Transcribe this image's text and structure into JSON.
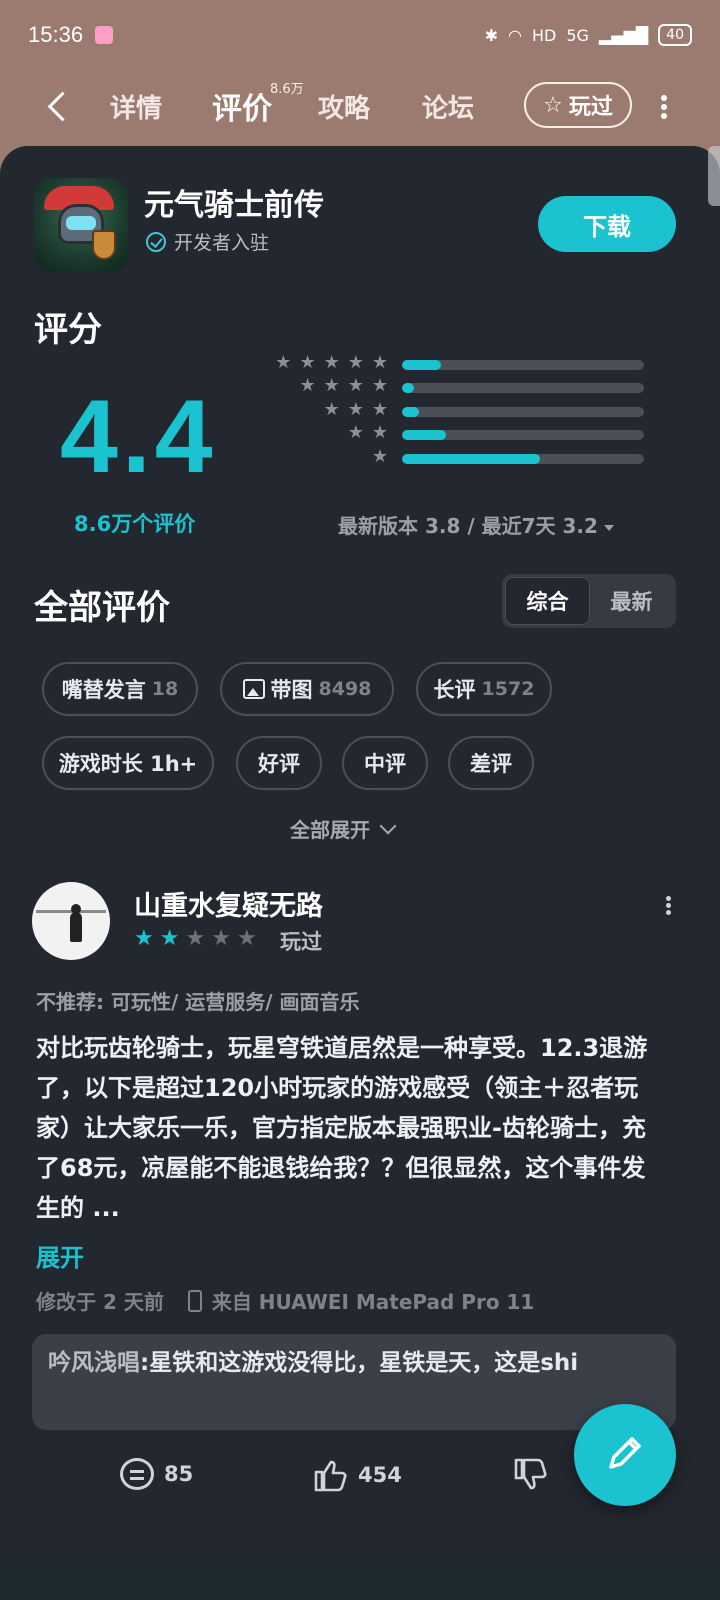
{
  "status_bar": {
    "time": "15:36",
    "network": "5G",
    "hd_label": "HD",
    "battery": "40"
  },
  "nav": {
    "tabs": [
      {
        "label": "详情"
      },
      {
        "label": "评价",
        "count": "8.6万"
      },
      {
        "label": "攻略"
      },
      {
        "label": "论坛"
      }
    ],
    "played_label": "玩过"
  },
  "app": {
    "title": "元气骑士前传",
    "developer_badge": "开发者入驻",
    "download_label": "下载"
  },
  "rating": {
    "section_title": "评分",
    "score": "4.4",
    "review_count_label": "8.6万个评价",
    "version_rating": "最新版本 3.8 / 最近7天 3.2",
    "distribution": [
      {
        "stars": 5,
        "fraction": 0.16
      },
      {
        "stars": 4,
        "fraction": 0.05
      },
      {
        "stars": 3,
        "fraction": 0.07
      },
      {
        "stars": 2,
        "fraction": 0.18
      },
      {
        "stars": 1,
        "fraction": 0.57
      }
    ]
  },
  "reviews": {
    "section_title": "全部评价",
    "sort_options": [
      "综合",
      "最新"
    ],
    "filters": [
      {
        "label": "嘴替发言",
        "count": "18"
      },
      {
        "label": "带图",
        "count": "8498"
      },
      {
        "label": "长评",
        "count": "1572"
      },
      {
        "label": "游戏时长 1h+",
        "count": ""
      },
      {
        "label": "好评",
        "count": ""
      },
      {
        "label": "中评",
        "count": ""
      },
      {
        "label": "差评",
        "count": ""
      }
    ],
    "expand_all_label": "全部展开"
  },
  "review": {
    "username": "山重水复疑无路",
    "stars": 2,
    "played_tag": "玩过",
    "not_recommend": "不推荐: 可玩性/ 运营服务/ 画面音乐",
    "text": "对比玩齿轮骑士，玩星穹铁道居然是一种享受。12.3退游了，以下是超过120小时玩家的游戏感受（领主＋忍者玩家）让大家乐一乐，官方指定版本最强职业-齿轮骑士，充了68元，凉屋能不能退钱给我？？但很显然，这个事件发生的 ...",
    "expand_label": "展开",
    "modified": "修改于 2 天前",
    "device": "来自 HUAWEI MatePad Pro 11",
    "reply_author": "吟风浅唱",
    "reply_text": "星铁和这游戏没得比，星铁是天，这是shi",
    "comment_count": "85",
    "like_count": "454"
  },
  "colors": {
    "accent": "#1ac3cf",
    "panel_bg": "#23272f",
    "header_bg": "#9b7b6f"
  }
}
